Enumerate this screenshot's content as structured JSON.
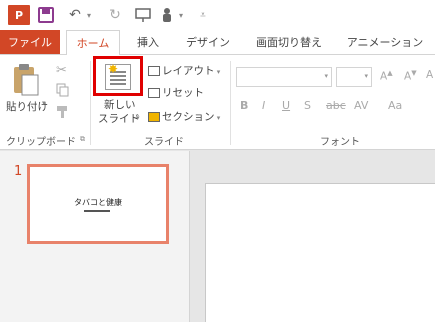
{
  "qat": {
    "app_logo": "P",
    "icons": [
      "powerpoint-logo-icon",
      "save-icon",
      "undo-icon",
      "redo-icon",
      "present-icon",
      "touch-mode-icon",
      "customize-icon"
    ]
  },
  "tabs": [
    {
      "label": "ファイル"
    },
    {
      "label": "ホーム"
    },
    {
      "label": "挿入"
    },
    {
      "label": "デザイン"
    },
    {
      "label": "画面切り替え"
    },
    {
      "label": "アニメーション"
    }
  ],
  "ribbon": {
    "clipboard": {
      "paste_label": "貼り付け",
      "group_label": "クリップボード"
    },
    "slides": {
      "new_slide_line1": "新しい",
      "new_slide_line2": "スライド",
      "layout_label": "レイアウト",
      "reset_label": "リセット",
      "section_label": "セクション",
      "group_label": "スライド"
    },
    "font": {
      "group_label": "フォント",
      "format_buttons": [
        "B",
        "I",
        "U",
        "S",
        "abc",
        "AV",
        "Aa"
      ]
    }
  },
  "colors": {
    "accent": "#d24726",
    "highlight_box": "#e00000",
    "thumb_border": "#e8826a"
  },
  "thumbnails": [
    {
      "number": "1",
      "title": "タバコと健康"
    }
  ]
}
